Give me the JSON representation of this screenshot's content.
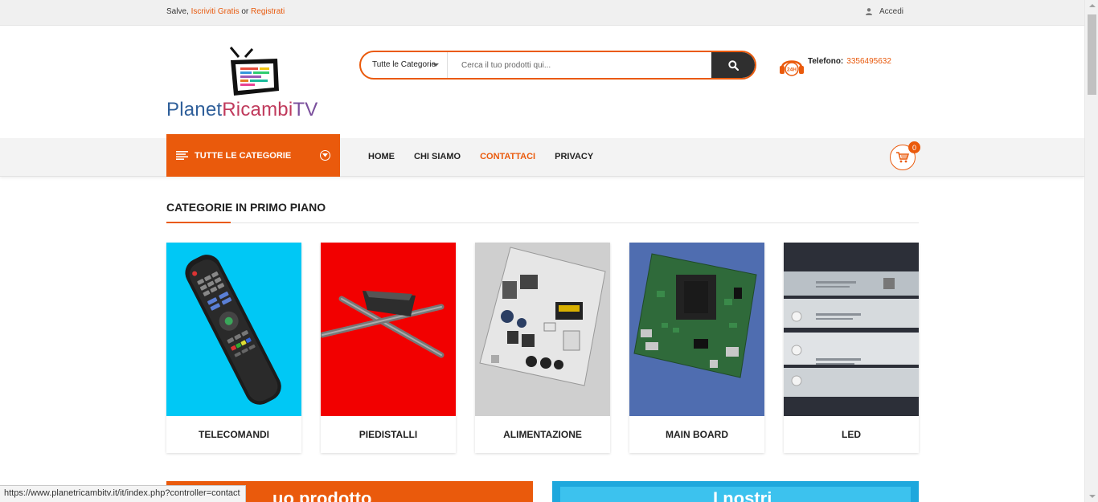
{
  "topbar": {
    "greeting": "Salve,",
    "signup": "Iscriviti Gratis",
    "or": "or",
    "register": "Registrati",
    "login": "Accedi"
  },
  "header": {
    "logo": {
      "part1": "Planet",
      "part2": "Ricambi",
      "part3": "TV"
    },
    "search": {
      "category_selected": "Tutte le Categorie",
      "placeholder": "Cerca il tuo prodotti qui...",
      "button_icon": "search-icon"
    },
    "phone": {
      "label": "Telefono:",
      "number": "3356495632",
      "icon": "headset-24h-icon",
      "badge": "24H"
    }
  },
  "navbar": {
    "all_categories": "TUTTE LE CATEGORIE",
    "links": [
      {
        "label": "HOME",
        "active": false
      },
      {
        "label": "CHI SIAMO",
        "active": false
      },
      {
        "label": "CONTATTACI",
        "active": true
      },
      {
        "label": "PRIVACY",
        "active": false
      }
    ],
    "cart_count": "0"
  },
  "section": {
    "title": "CATEGORIE IN PRIMO PIANO",
    "categories": [
      {
        "name": "TELECOMANDI",
        "bg": "#00c8f5"
      },
      {
        "name": "PIEDISTALLI",
        "bg": "#f20000"
      },
      {
        "name": "ALIMENTAZIONE",
        "bg": "#cfcfcf"
      },
      {
        "name": "MAIN BOARD",
        "bg": "#4f6db0"
      },
      {
        "name": "LED",
        "bg": "#2c2f38"
      }
    ]
  },
  "banners": {
    "left_text": "uo prodotto",
    "right_text": "I nostri"
  },
  "status_url": "https://www.planetricambitv.it/it/index.php?controller=contact",
  "colors": {
    "accent": "#ea5a0c",
    "dark": "#2f2f2f"
  }
}
